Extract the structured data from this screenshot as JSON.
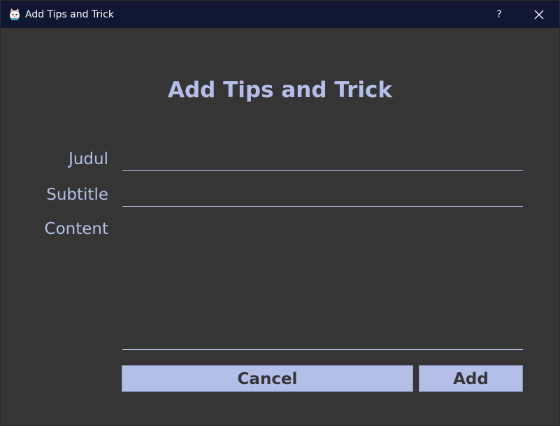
{
  "window": {
    "title": "Add Tips and Trick",
    "help_glyph": "?",
    "app_icon": "cat-mascot-icon",
    "close_icon": "close-icon"
  },
  "form": {
    "heading": "Add Tips and Trick",
    "judul_label": "Judul",
    "subtitle_label": "Subtitle",
    "content_label": "Content",
    "judul_value": "",
    "subtitle_value": "",
    "content_value": ""
  },
  "buttons": {
    "cancel_label": "Cancel",
    "add_label": "Add"
  },
  "colors": {
    "titlebar": "#0f1733",
    "background": "#353535",
    "accent": "#b3bfe8",
    "button_text": "#363636"
  }
}
